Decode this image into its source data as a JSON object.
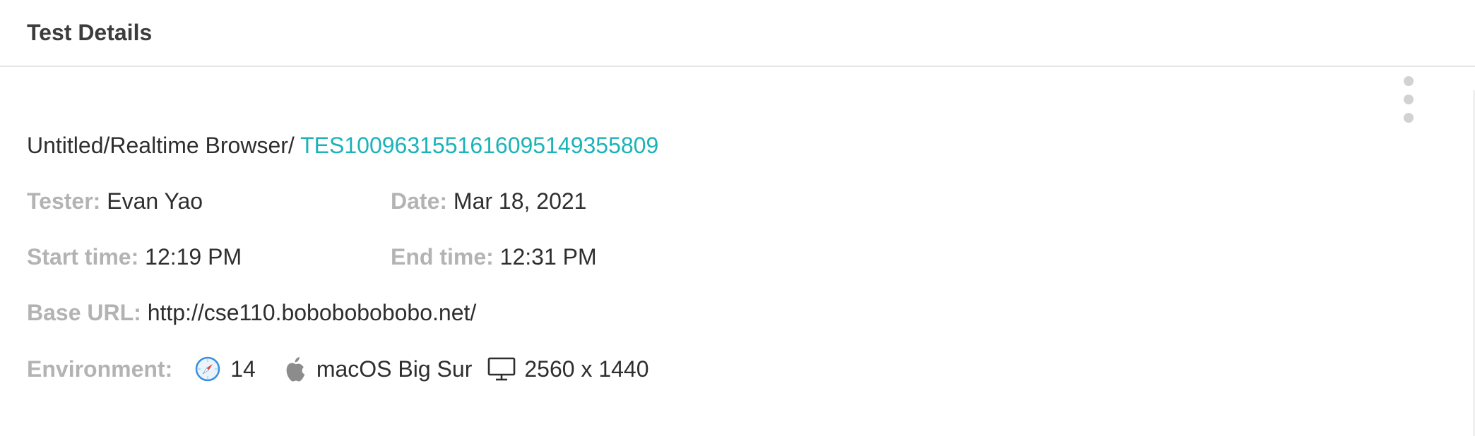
{
  "header": {
    "title": "Test Details"
  },
  "test": {
    "path_prefix": "Untitled/Realtime Browser/",
    "test_id": "TES1009631551616095149355809"
  },
  "fields": {
    "tester_label": "Tester:",
    "tester_value": "Evan Yao",
    "date_label": "Date:",
    "date_value": "Mar 18, 2021",
    "start_label": "Start time:",
    "start_value": "12:19 PM",
    "end_label": "End time:",
    "end_value": "12:31 PM",
    "base_url_label": "Base URL:",
    "base_url_value": "http://cse110.bobobobobobo.net/"
  },
  "environment": {
    "label": "Environment:",
    "browser_icon": "safari-icon",
    "browser_version": "14",
    "os_icon": "apple-icon",
    "os_name": "macOS Big Sur",
    "display_icon": "monitor-icon",
    "resolution": "2560 x 1440"
  },
  "colors": {
    "link": "#1ab3b8",
    "label": "#b3b3b3",
    "text": "#2e2e2e"
  }
}
